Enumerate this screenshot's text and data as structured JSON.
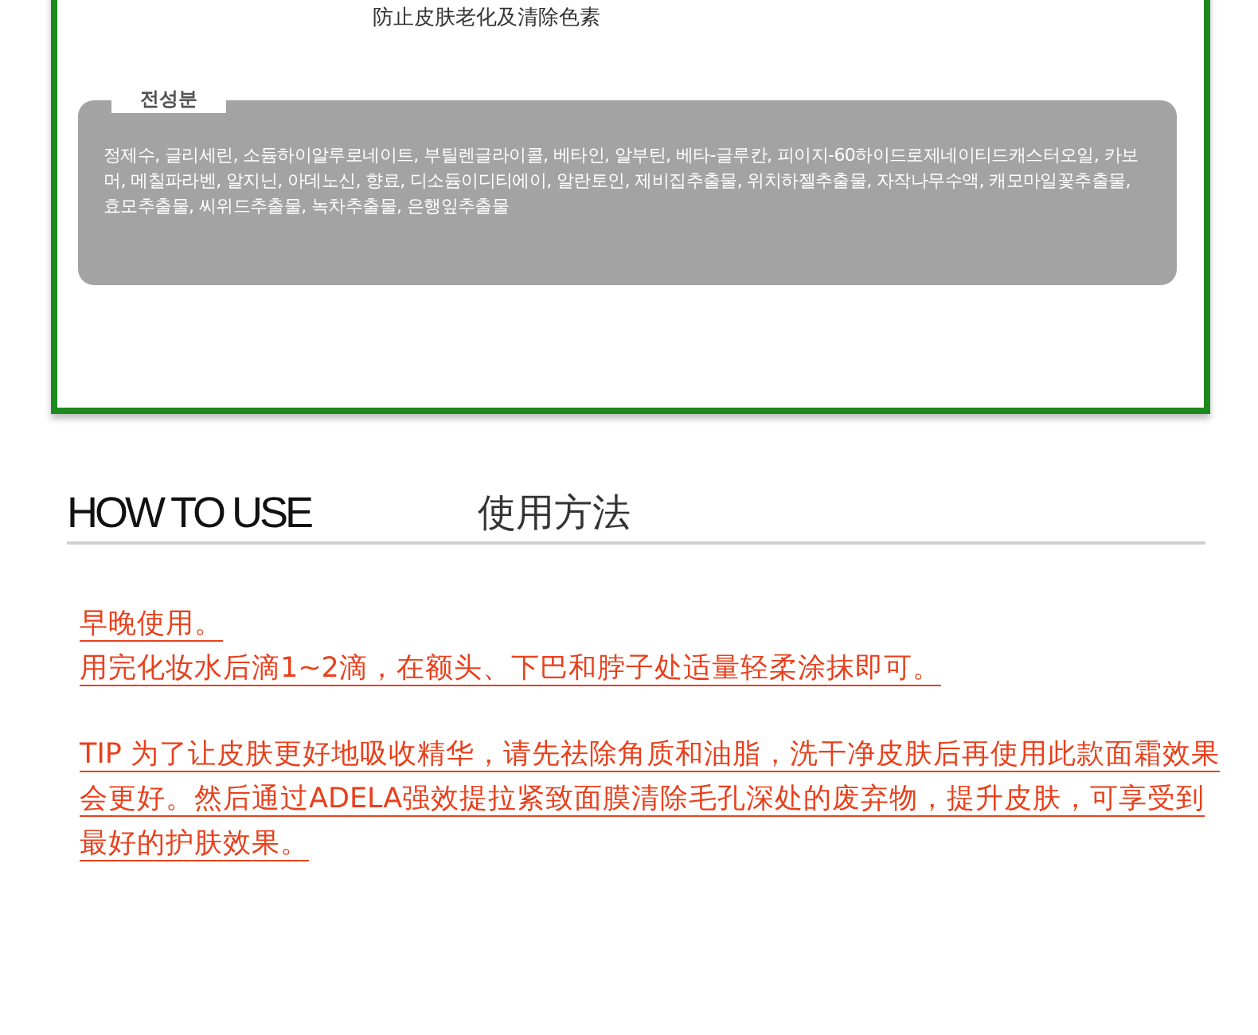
{
  "product_card": {
    "feature_text": "防止皮肤老化及清除色素",
    "ingredients": {
      "label": "전성분",
      "text": "정제수, 글리세린, 소듐하이알루로네이트, 부틸렌글라이콜, 베타인, 알부틴, 베타-글루칸, 피이지-60하이드로제네이티드캐스터오일, 카보머, 메칠파라벤, 알지닌, 아데노신, 향료, 디소듐이디티에이, 알란토인, 제비집추출물, 위치하젤추출물, 자작나무수액, 캐모마일꽃추출물, 효모추출물, 씨위드추출물, 녹차추출물, 은행잎추출물"
    }
  },
  "how_to_use": {
    "title": "HOW TO USE",
    "title_cn": "使用方法",
    "paragraphs": [
      {
        "lines": [
          "早晚使用。",
          "用完化妆水后滴1~2滴，在额头、下巴和脖子处适量轻柔涂抹即可。"
        ]
      },
      {
        "lines": [
          "TIP  为了让皮肤更好地吸收精华，请先祛除角质和油脂，洗干净皮肤后再使用此款面霜效果会更好。然后通过ADELA强效提拉紧致面膜清除毛孔深处的废弃物，提升皮肤，可享受到最好的护肤效果。"
        ]
      }
    ]
  }
}
